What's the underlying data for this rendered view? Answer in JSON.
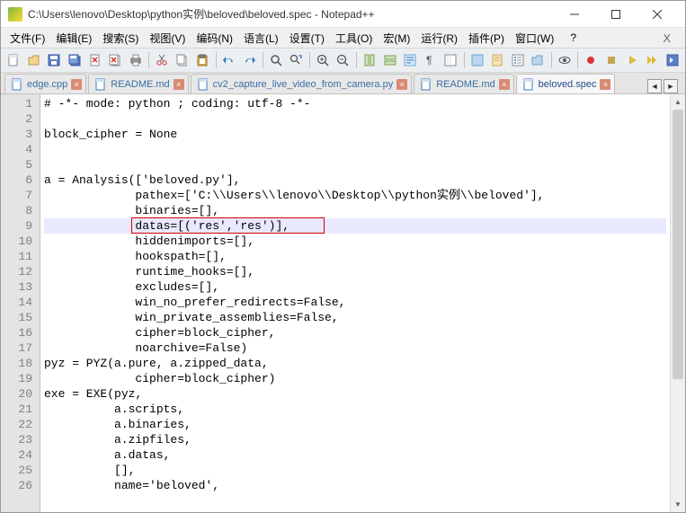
{
  "window": {
    "title": "C:\\Users\\lenovo\\Desktop\\python实例\\beloved\\beloved.spec - Notepad++"
  },
  "menu": {
    "file": "文件(F)",
    "edit": "编辑(E)",
    "search": "搜索(S)",
    "view": "视图(V)",
    "encoding": "编码(N)",
    "language": "语言(L)",
    "settings": "设置(T)",
    "tools": "工具(O)",
    "macro": "宏(M)",
    "run": "运行(R)",
    "plugins": "插件(P)",
    "window": "窗口(W)",
    "help": "?",
    "extra_x": "X"
  },
  "tabs": [
    {
      "label": "edge.cpp",
      "active": false
    },
    {
      "label": "README.md",
      "active": false
    },
    {
      "label": "cv2_capture_live_video_from_camera.py",
      "active": false
    },
    {
      "label": "README.md",
      "active": false
    },
    {
      "label": "beloved.spec",
      "active": true
    }
  ],
  "tabnav": {
    "left": "◄",
    "right": "►"
  },
  "scrollbar": {
    "up": "▲",
    "down": "▼"
  },
  "code_lines": [
    "# -*- mode: python ; coding: utf-8 -*-",
    "",
    "block_cipher = None",
    "",
    "",
    "a = Analysis(['beloved.py'],",
    "             pathex=['C:\\\\Users\\\\lenovo\\\\Desktop\\\\python实例\\\\beloved'],",
    "             binaries=[],",
    "             datas=[('res','res')],",
    "             hiddenimports=[],",
    "             hookspath=[],",
    "             runtime_hooks=[],",
    "             excludes=[],",
    "             win_no_prefer_redirects=False,",
    "             win_private_assemblies=False,",
    "             cipher=block_cipher,",
    "             noarchive=False)",
    "pyz = PYZ(a.pure, a.zipped_data,",
    "             cipher=block_cipher)",
    "exe = EXE(pyz,",
    "          a.scripts,",
    "          a.binaries,",
    "          a.zipfiles,",
    "          a.datas,",
    "          [],",
    "          name='beloved',"
  ],
  "highlighted_line_index": 8,
  "red_box": {
    "line_index": 8,
    "col_start": 13,
    "col_end": 40
  },
  "line_count": 26
}
